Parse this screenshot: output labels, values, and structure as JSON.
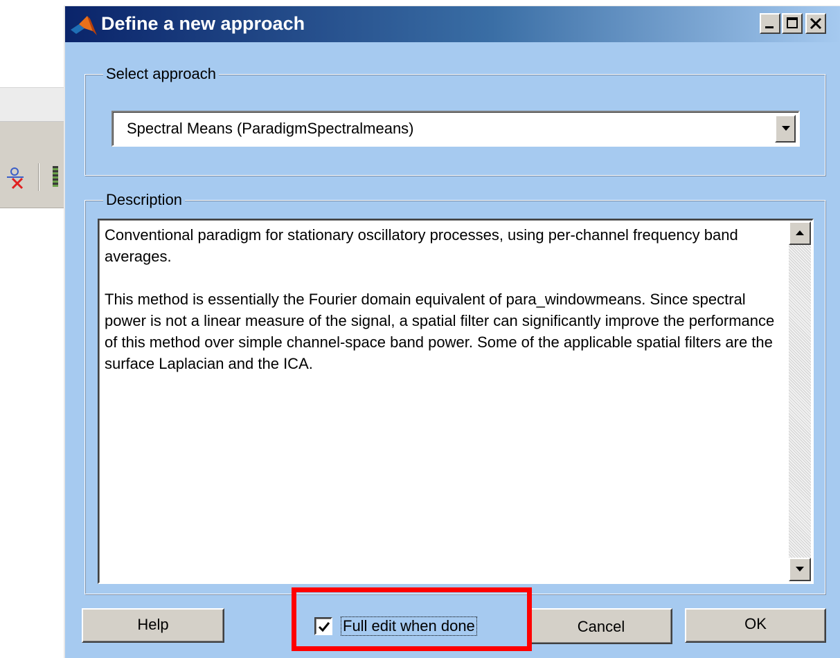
{
  "window": {
    "title": "Define a new approach",
    "title_icon": "matlab-logo-icon",
    "controls": [
      "minimize-icon",
      "maximize-icon",
      "close-icon"
    ]
  },
  "select_approach": {
    "label": "Select approach",
    "selected_value": "Spectral Means (ParadigmSpectralmeans)"
  },
  "description": {
    "label": "Description",
    "paragraphs": [
      "Conventional paradigm for stationary oscillatory processes, using per-channel frequency band averages.",
      "This method is essentially the Fourier domain equivalent of para_windowmeans. Since spectral power is not a linear measure of the signal, a spatial filter can significantly improve the performance of this method over simple channel-space band power. Some of the applicable spatial filters are the surface Laplacian and the ICA."
    ]
  },
  "buttons": {
    "help": "Help",
    "cancel": "Cancel",
    "ok": "OK"
  },
  "checkbox": {
    "label": "Full edit when done",
    "checked": true
  },
  "colors": {
    "dialog_background": "#a6caf0",
    "titlebar_start": "#0a246a",
    "highlight": "#ff0000"
  }
}
